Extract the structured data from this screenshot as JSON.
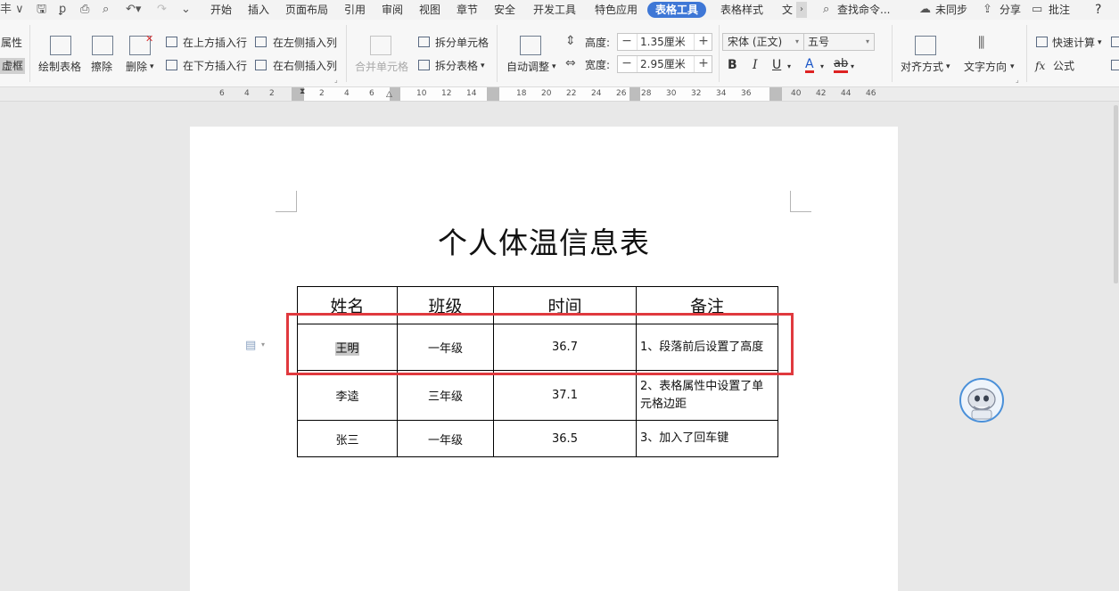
{
  "tabs": [
    "开始",
    "插入",
    "页面布局",
    "引用",
    "审阅",
    "视图",
    "章节",
    "安全",
    "开发工具",
    "特色应用",
    "表格工具",
    "表格样式",
    "文"
  ],
  "active_tab": "表格工具",
  "topright": {
    "search": "查找命令...",
    "sync": "未同步",
    "share": "分享",
    "comment": "批注",
    "help": "?"
  },
  "ribbon": {
    "properties": "属性",
    "dashed_border": "虚框",
    "draw_table": "绘制表格",
    "erase": "擦除",
    "delete": "删除",
    "insert_row_above": "在上方插入行",
    "insert_row_below": "在下方插入行",
    "insert_col_left": "在左侧插入列",
    "insert_col_right": "在右侧插入列",
    "merge_cells": "合并单元格",
    "split_cells": "拆分单元格",
    "split_table": "拆分表格",
    "auto_adjust": "自动调整",
    "height_label": "高度:",
    "height_value": "1.35厘米",
    "width_label": "宽度:",
    "width_value": "2.95厘米",
    "font_name": "宋体 (正文)",
    "font_size": "五号",
    "align": "对齐方式",
    "text_direction": "文字方向",
    "quick_calc": "快速计算",
    "formula": "公式",
    "formula_fx": "fx",
    "bold": "B",
    "italic": "I",
    "underline": "U",
    "font_color": "A",
    "highlight": "ab"
  },
  "ruler_ticks": [
    "6",
    "4",
    "2",
    "2",
    "4",
    "6",
    "10",
    "12",
    "14",
    "18",
    "20",
    "22",
    "24",
    "26",
    "28",
    "30",
    "32",
    "34",
    "36",
    "40",
    "42",
    "44",
    "46"
  ],
  "document": {
    "title": "个人体温信息表",
    "table": {
      "headers": [
        "姓名",
        "班级",
        "时间",
        "备注"
      ],
      "rows": [
        [
          "王明",
          "一年级",
          "36.7",
          "1、段落前后设置了高度"
        ],
        [
          "李逵",
          "三年级",
          "37.1",
          "2、表格属性中设置了单元格边距"
        ],
        [
          "张三",
          "一年级",
          "36.5",
          "3、加入了回车键"
        ]
      ]
    }
  },
  "colors": {
    "active_tab": "#3e77d6",
    "annotation_box": "#e0393e",
    "selection": "#c8c8c8"
  }
}
